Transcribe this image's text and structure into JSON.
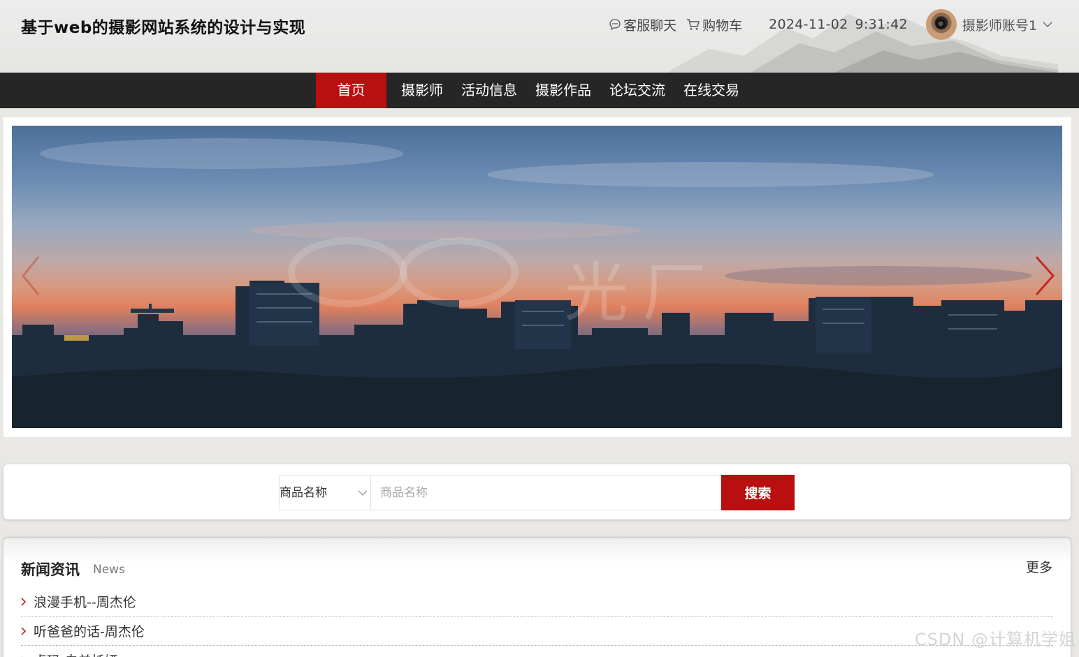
{
  "header": {
    "title": "基于web的摄影网站系统的设计与实现",
    "links": [
      {
        "label": "客服聊天",
        "icon": "chat-icon"
      },
      {
        "label": "购物车",
        "icon": "cart-icon"
      }
    ],
    "date": "2024-11-02",
    "time": "9:31:42",
    "username": "摄影师账号1"
  },
  "nav": {
    "items": [
      "首页",
      "摄影师",
      "活动信息",
      "摄影作品",
      "论坛交流",
      "在线交易"
    ],
    "active_index": 0
  },
  "banner": {
    "watermark": "光厂"
  },
  "search": {
    "select_value": "商品名称",
    "placeholder": "商品名称",
    "button_label": "搜索"
  },
  "news": {
    "title": "新闻资讯",
    "subtitle": "News",
    "more": "更多",
    "items": [
      "浪漫手机--周杰伦",
      "听爸爸的话-周杰伦",
      "卓玛-白羊托娅"
    ]
  },
  "watermark": "CSDN @计算机学姐",
  "colors": {
    "accent": "#b90f0f",
    "nav_bg": "#262626",
    "page_bg": "#e9e8e4"
  }
}
